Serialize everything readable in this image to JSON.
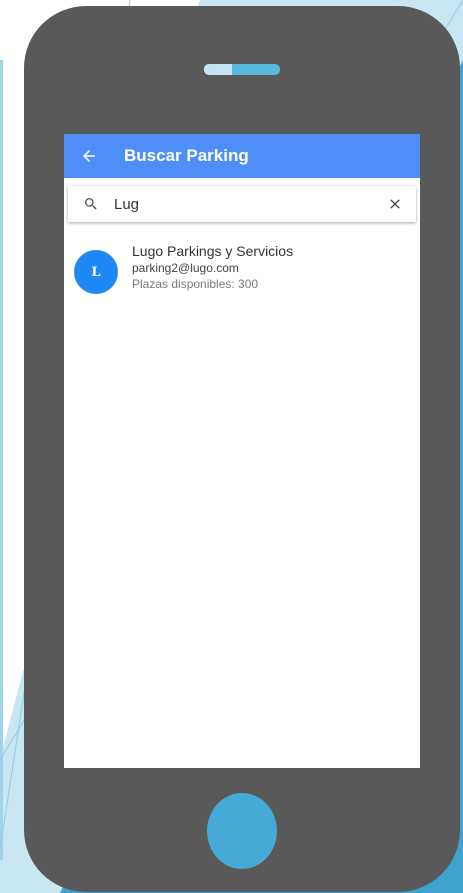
{
  "colors": {
    "appbar": "#4f8ef7",
    "avatar": "#1e88f5",
    "phone_body": "#595959",
    "accent": "#45aad5"
  },
  "appbar": {
    "back_icon": "arrow-left-icon",
    "title": "Buscar Parking"
  },
  "search": {
    "icon": "search-icon",
    "value": "Lug",
    "clear_icon": "close-icon"
  },
  "results": [
    {
      "avatar_letter": "L",
      "name": "Lugo Parkings y Servicios",
      "email": "parking2@lugo.com",
      "spaces": "Plazas disponibles: 300"
    }
  ]
}
